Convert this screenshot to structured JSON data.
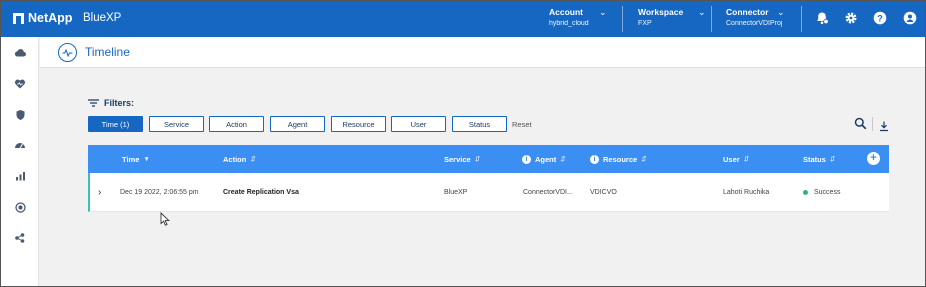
{
  "brand": {
    "logo_text": "NetApp",
    "product": "BlueXP",
    "color": "#1667c2"
  },
  "context": {
    "account": {
      "label": "Account",
      "value": "hybrid_cloud"
    },
    "workspace": {
      "label": "Workspace",
      "value": "FXP"
    },
    "connector": {
      "label": "Connector",
      "value": "ConnectorVDIProj"
    }
  },
  "top_icons": [
    "notifications-icon",
    "gear-icon",
    "help-icon",
    "user-icon"
  ],
  "rail_icons": [
    "canvas-icon",
    "health-icon",
    "protection-icon",
    "governance-icon",
    "mobility-icon",
    "extensions-icon",
    "more-icon"
  ],
  "page": {
    "title": "Timeline"
  },
  "filters": {
    "label": "Filters:",
    "chips": [
      "Time (1)",
      "Service",
      "Action",
      "Agent",
      "Resource",
      "User",
      "Status"
    ],
    "active_index": 0,
    "reset": "Reset"
  },
  "table": {
    "columns": [
      "Time",
      "Action",
      "Service",
      "Agent",
      "Resource",
      "User",
      "Status"
    ],
    "rows": [
      {
        "time": "Dec 19 2022, 2:06:55 pm",
        "action": "Create Replication Vsa",
        "service": "BlueXP",
        "agent": "ConnectorVDI...",
        "resource": "VDICVO",
        "user": "Lahoti Ruchika",
        "status": "Success",
        "status_color": "#2cb67d"
      }
    ]
  },
  "colors": {
    "header_bg": "#3b8ef2",
    "accent": "#37c2b4"
  }
}
